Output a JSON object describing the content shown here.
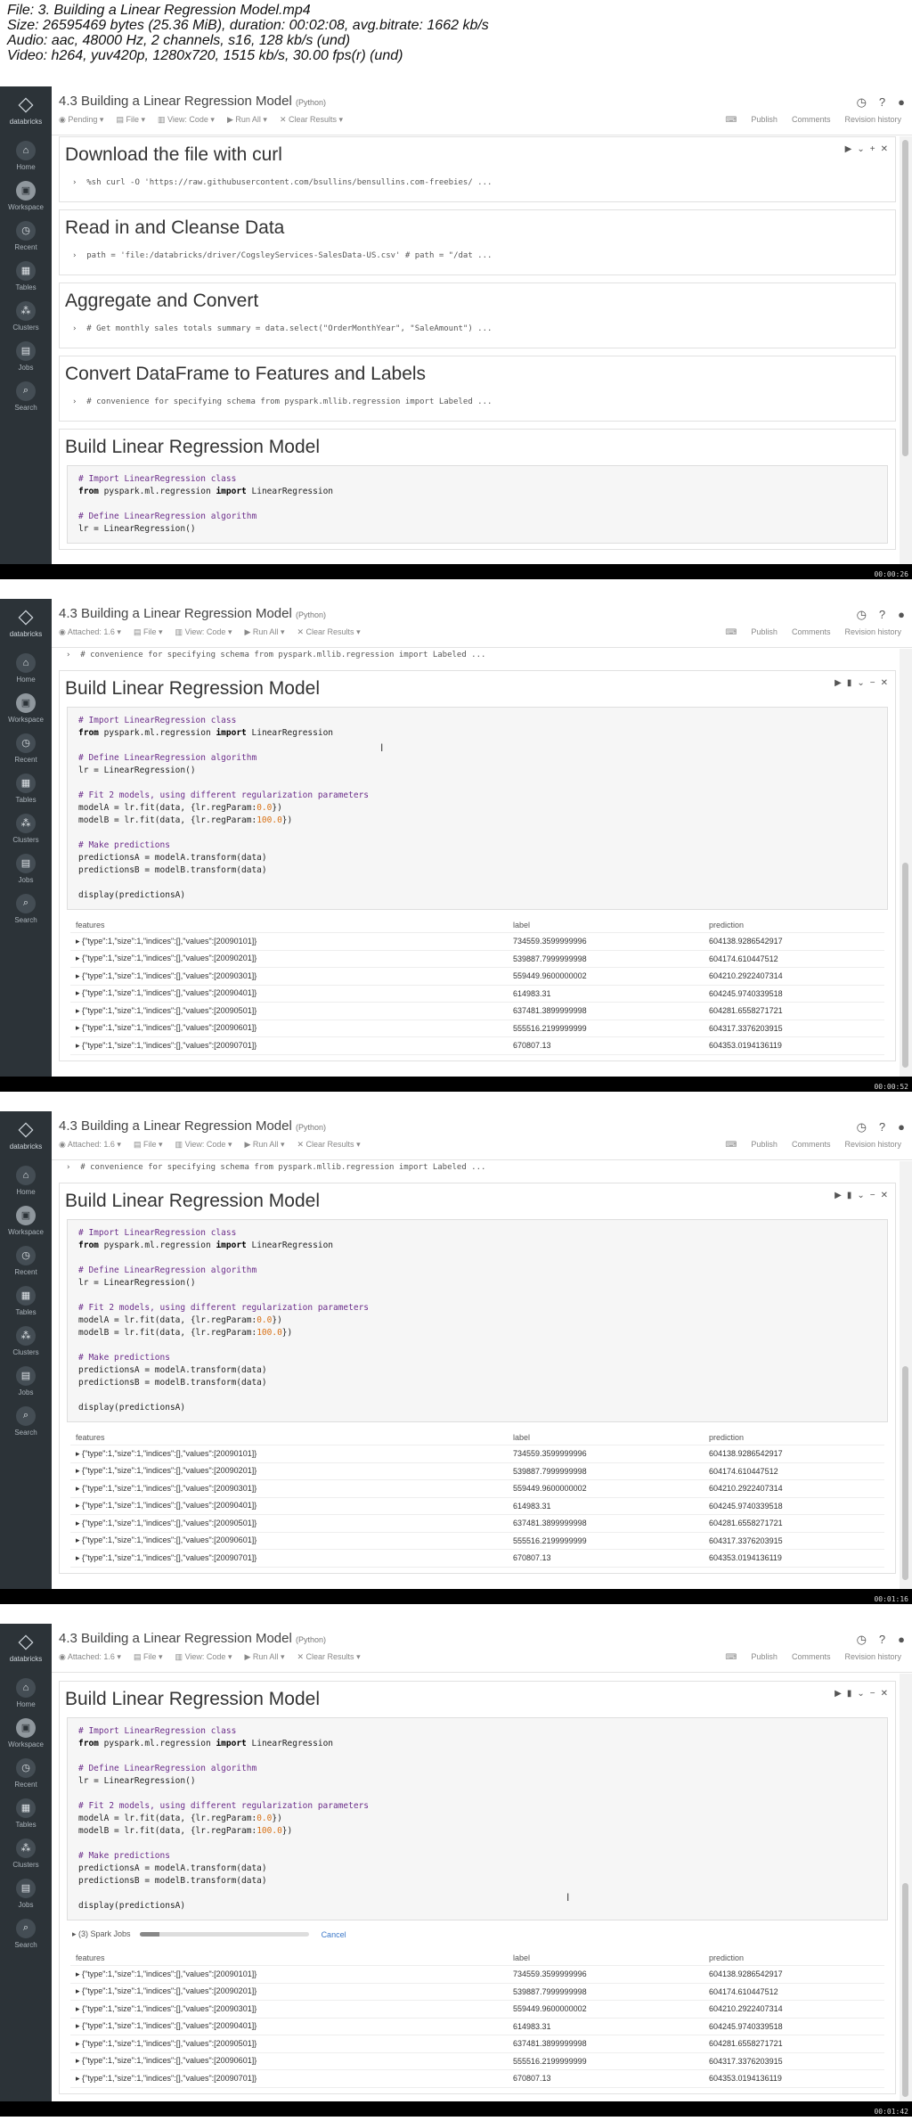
{
  "file_header": {
    "file": "File: 3. Building a Linear Regression Model.mp4",
    "size": "Size: 26595469 bytes (25.36 MiB), duration: 00:02:08, avg.bitrate: 1662 kb/s",
    "audio": "Audio: aac, 48000 Hz, 2 channels, s16, 128 kb/s (und)",
    "video": "Video: h264, yuv420p, 1280x720, 1515 kb/s, 30.00 fps(r) (und)"
  },
  "notebook": {
    "title": "4.3 Building a Linear Regression Model",
    "language": "(Python)",
    "sidebar": {
      "logo": "databricks",
      "items": [
        "Home",
        "Workspace",
        "Recent",
        "Tables",
        "Clusters",
        "Jobs",
        "Search"
      ]
    },
    "toolbar_pending": [
      "Pending",
      "File",
      "View: Code",
      "Run All",
      "Clear Results"
    ],
    "toolbar_attached": [
      "Attached: 1.6",
      "File",
      "View: Code",
      "Run All",
      "Clear Results"
    ],
    "toolbar_right": [
      "Publish",
      "Comments",
      "Revision history"
    ],
    "frame1_cells": [
      {
        "title": "Download the file with curl",
        "code": "%sh curl -O 'https://raw.githubusercontent.com/bsullins/bensullins.com-freebies/ ..."
      },
      {
        "title": "Read in and Cleanse Data",
        "code": "path = 'file:/databricks/driver/CogsleyServices-SalesData-US.csv' # path = \"/dat ..."
      },
      {
        "title": "Aggregate and Convert",
        "code": "# Get monthly sales totals summary = data.select(\"OrderMonthYear\", \"SaleAmount\") ..."
      },
      {
        "title": "Convert DataFrame to Features and Labels",
        "code": "# convenience for specifying schema from pyspark.mllib.regression import Labeled ..."
      },
      {
        "title": "Build Linear Regression Model",
        "code": ""
      }
    ],
    "collapsed_line": "# convenience for specifying schema from pyspark.mllib.regression import Labeled ...",
    "model_title": "Build Linear Regression Model",
    "code_lines": [
      "# Import LinearRegression class",
      "from pyspark.ml.regression import LinearRegression",
      "",
      "# Define LinearRegression algorithm",
      "lr = LinearRegression()",
      "",
      "# Fit 2 models, using different regularization parameters",
      "modelA = lr.fit(data, {lr.regParam:0.0})",
      "modelB = lr.fit(data, {lr.regParam:100.0})",
      "",
      "# Make predictions",
      "predictionsA = modelA.transform(data)",
      "predictionsB = modelB.transform(data)",
      "",
      "display(predictionsA)"
    ],
    "table": {
      "headers": [
        "features",
        "label",
        "prediction"
      ],
      "rows": [
        [
          "{\"type\":1,\"size\":1,\"indices\":[],\"values\":[20090101]}",
          "734559.3599999996",
          "604138.9286542917"
        ],
        [
          "{\"type\":1,\"size\":1,\"indices\":[],\"values\":[20090201]}",
          "539887.7999999998",
          "604174.610447512"
        ],
        [
          "{\"type\":1,\"size\":1,\"indices\":[],\"values\":[20090301]}",
          "559449.9600000002",
          "604210.2922407314"
        ],
        [
          "{\"type\":1,\"size\":1,\"indices\":[],\"values\":[20090401]}",
          "614983.31",
          "604245.9740339518"
        ],
        [
          "{\"type\":1,\"size\":1,\"indices\":[],\"values\":[20090501]}",
          "637481.3899999998",
          "604281.6558271721"
        ],
        [
          "{\"type\":1,\"size\":1,\"indices\":[],\"values\":[20090601]}",
          "555516.2199999999",
          "604317.3376203915"
        ],
        [
          "{\"type\":1,\"size\":1,\"indices\":[],\"values\":[20090701]}",
          "670807.13",
          "604353.0194136119"
        ]
      ]
    },
    "spark_jobs": {
      "label": "(3) Spark Jobs",
      "cancel": "Cancel",
      "progress": 0.12
    }
  },
  "timestamps": [
    "00:00:26",
    "00:00:52",
    "00:01:16",
    "00:01:42"
  ]
}
